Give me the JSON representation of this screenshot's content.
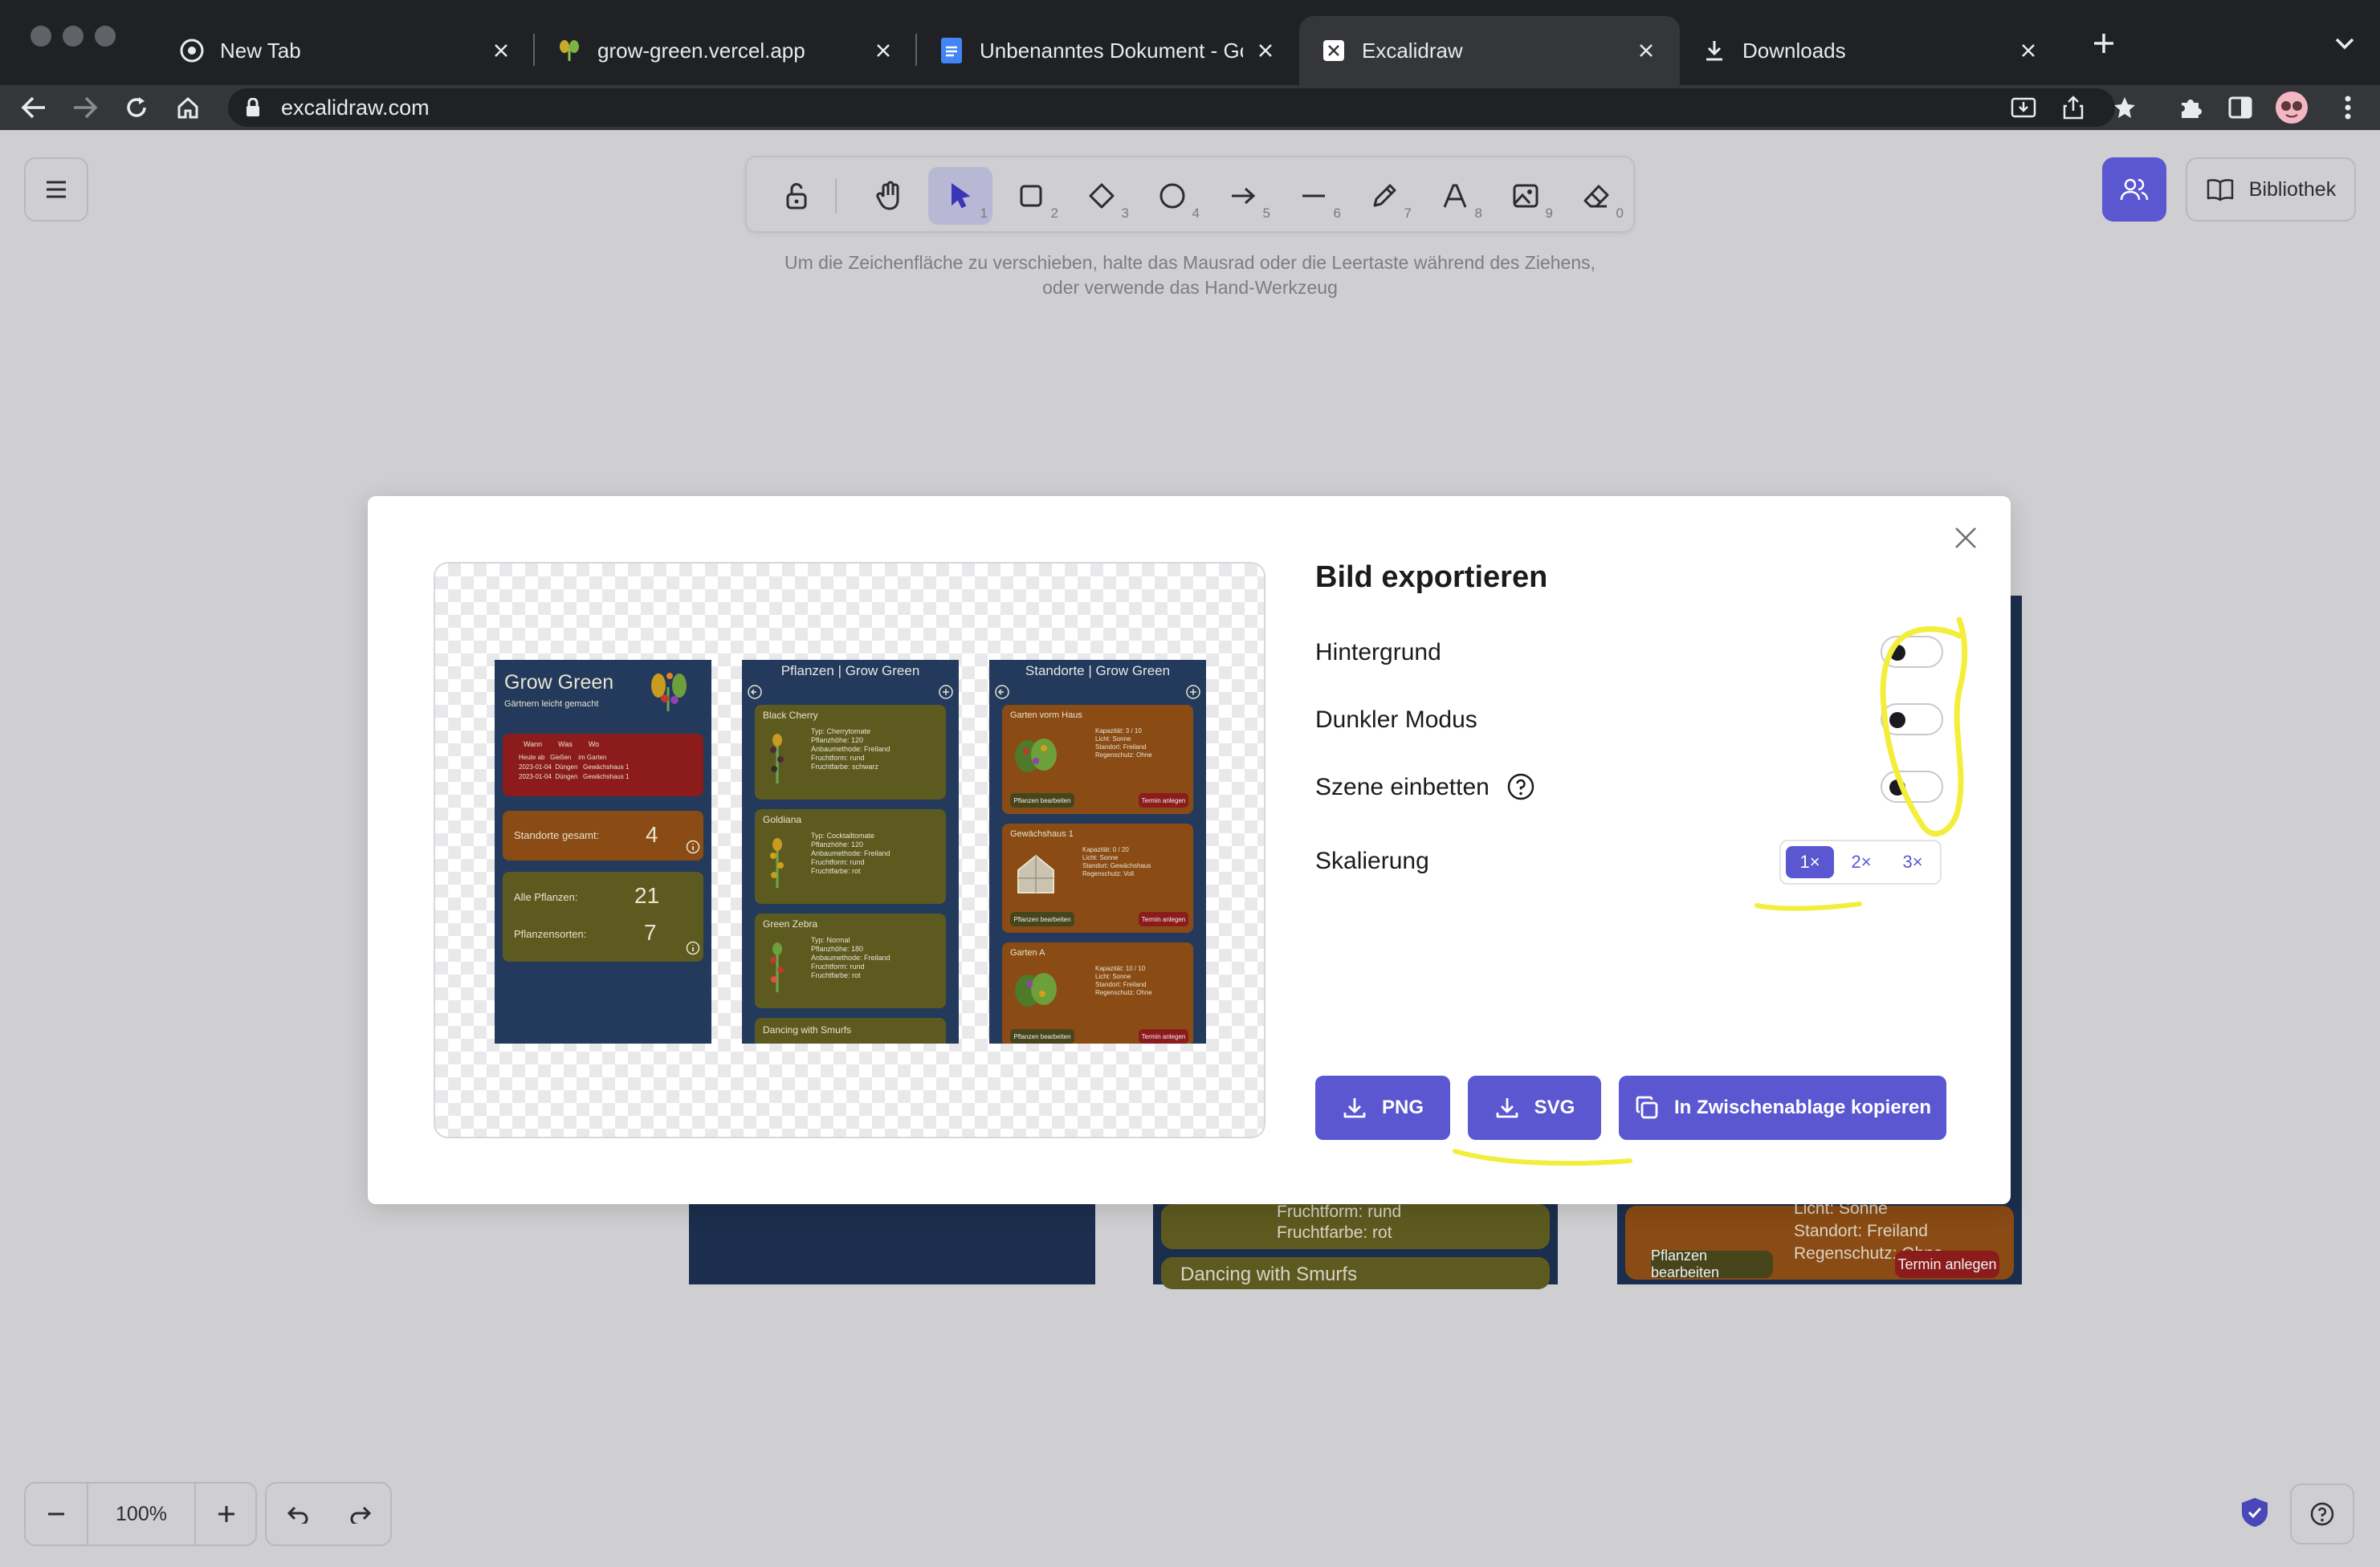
{
  "browser": {
    "tabs": [
      {
        "title": "New Tab",
        "icon": "chrome-icon"
      },
      {
        "title": "grow-green.vercel.app",
        "icon": "plant-favicon"
      },
      {
        "title": "Unbenanntes Dokument - Goo",
        "icon": "google-docs-icon"
      },
      {
        "title": "Excalidraw",
        "icon": "excalidraw-favicon"
      },
      {
        "title": "Downloads",
        "icon": "download-icon"
      }
    ],
    "url": "excalidraw.com"
  },
  "excalidraw": {
    "toolbar_hint": "Um die Zeichenfläche zu verschieben, halte das Mausrad oder die Leertaste während des Ziehens, oder verwende das Hand-Werkzeug",
    "tool_shortcuts": [
      "1",
      "2",
      "3",
      "4",
      "5",
      "6",
      "7",
      "8",
      "9",
      "0"
    ],
    "library_label": "Bibliothek",
    "zoom_level": "100%"
  },
  "canvas_background": {
    "card_fruit_form": "Fruchtform: rund",
    "card_fruit_color": "Fruchtfarbe: rot",
    "card_dancing": "Dancing with Smurfs",
    "card_light": "Licht: Sonne",
    "card_location": "Standort: Freiland",
    "card_rain": "Regenschutz: Ohne",
    "btn_edit_plants": "Pflanzen bearbeiten",
    "btn_appointment": "Termin anlegen"
  },
  "export_dialog": {
    "title": "Bild exportieren",
    "options": {
      "background": "Hintergrund",
      "dark_mode": "Dunkler Modus",
      "embed_scene": "Szene einbetten",
      "scale": "Skalierung"
    },
    "toggles": {
      "background": false,
      "dark_mode": false,
      "embed_scene": false
    },
    "scale_options": [
      "1×",
      "2×",
      "3×"
    ],
    "scale_selected": "1×",
    "buttons": {
      "png": "PNG",
      "svg": "SVG",
      "clipboard": "In Zwischenablage kopieren"
    }
  },
  "preview": {
    "screen1": {
      "title": "Grow Green",
      "subtitle": "Gärtnern leicht gemacht",
      "table_header": "Wann        Was        Wo",
      "table_rows": "Heute ab   Gießen    im Garten\n2023-01-04  Düngen   Gewächshaus 1\n2023-01-04  Düngen   Gewächshaus 1",
      "locations_label": "Standorte gesamt:",
      "locations_value": "4",
      "all_plants_label": "Alle Pflanzen:",
      "all_plants_value": "21",
      "varieties_label": "Pflanzensorten:",
      "varieties_value": "7"
    },
    "screen2": {
      "title": "Pflanzen | Grow Green",
      "cards": [
        {
          "name": "Black Cherry",
          "details": "Typ: Cherrytomate\nPflanzhöhe: 120\nAnbaumethode: Freiland\nFruchtform: rund\nFruchtfarbe: schwarz"
        },
        {
          "name": "Goldiana",
          "details": "Typ: Cocktailtomate\nPflanzhöhe: 120\nAnbaumethode: Freiland\nFruchtform: rund\nFruchtfarbe: rot"
        },
        {
          "name": "Green Zebra",
          "details": "Typ: Normal\nPflanzhöhe: 180\nAnbaumethode: Freiland\nFruchtform: rund\nFruchtfarbe: rot"
        }
      ],
      "last_card": "Dancing with Smurfs"
    },
    "screen3": {
      "title": "Standorte | Grow Green",
      "cards": [
        {
          "name": "Garten vorm Haus",
          "details": "Kapazität: 3 / 10\nLicht: Sonne\nStandort: Freiland\nRegenschutz: Ohne"
        },
        {
          "name": "Gewächshaus 1",
          "details": "Kapazität: 0 / 20\nLicht: Sonne\nStandort: Gewächshaus\nRegenschutz: Voll"
        },
        {
          "name": "Garten A",
          "details": "Kapazität: 10 / 10\nLicht: Sonne\nStandort: Freiland\nRegenschutz: Ohne"
        }
      ],
      "btn_edit": "Pflanzen bearbeiten",
      "btn_appointment": "Termin anlegen"
    }
  },
  "colors": {
    "accent": "#5b57d1",
    "annotation": "#f3ee3a",
    "preview_navy": "#233a5c",
    "preview_olive": "#5d5a20",
    "preview_orange": "#8a4b14",
    "preview_red": "#8c1c1c"
  }
}
